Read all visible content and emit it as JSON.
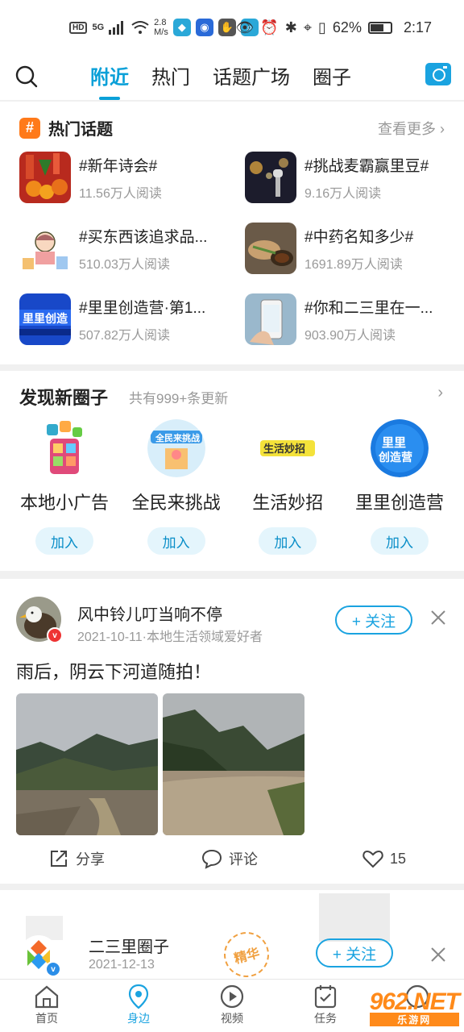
{
  "status_bar": {
    "hd": "HD",
    "network": "5G",
    "speed": "2.8\nM/s",
    "battery": "62%",
    "time": "2:17"
  },
  "nav": {
    "tabs": [
      "附近",
      "热门",
      "话题广场",
      "圈子"
    ],
    "active_tab": "附近"
  },
  "hot_topics": {
    "title": "热门话题",
    "more_label": "查看更多",
    "items": [
      {
        "name": "#新年诗会#",
        "reads": "11.56万人阅读",
        "thumb_color": "#c23b22"
      },
      {
        "name": "#挑战麦霸赢里豆#",
        "reads": "9.16万人阅读",
        "thumb_color": "#2a2a40"
      },
      {
        "name": "#买东西该追求品质还是性价比#",
        "display": "#买东西该追求品...",
        "reads": "510.03万人阅读",
        "thumb_color": "#f6e6d6"
      },
      {
        "name": "#中药名知多少#",
        "reads": "1691.89万人阅读",
        "thumb_color": "#8a6a4a"
      },
      {
        "name": "#里里创造营·第1...",
        "display": "#里里创造营·第1...",
        "reads": "507.82万人阅读",
        "thumb_color": "#1a4fd0"
      },
      {
        "name": "#你和二三里在一...",
        "display": "#你和二三里在一...",
        "reads": "903.90万人阅读",
        "thumb_color": "#a8c4d8"
      }
    ]
  },
  "discover": {
    "title": "发现新圈子",
    "subtitle": "共有999+条更新",
    "join_label": "加入",
    "circles": [
      {
        "name": "本地小广告"
      },
      {
        "name": "全民来挑战"
      },
      {
        "name": "生活妙招"
      },
      {
        "name": "里里创造营"
      }
    ]
  },
  "post": {
    "author": "风中铃儿叮当响不停",
    "meta": "2021-10-11·本地生活领域爱好者",
    "follow_label": "+ 关注",
    "text": "雨后，阴云下河道随拍！",
    "share_label": "分享",
    "comment_label": "评论",
    "likes": "15"
  },
  "post2": {
    "author": "二三里圈子",
    "date": "2021-12-13",
    "badge": "精华",
    "follow_label": "+ 关注"
  },
  "bottom_bar": {
    "items": [
      "首页",
      "身边",
      "视频",
      "任务",
      ""
    ],
    "active": "身边"
  },
  "watermark": {
    "brand": "962.NET",
    "sub": "乐游网"
  }
}
